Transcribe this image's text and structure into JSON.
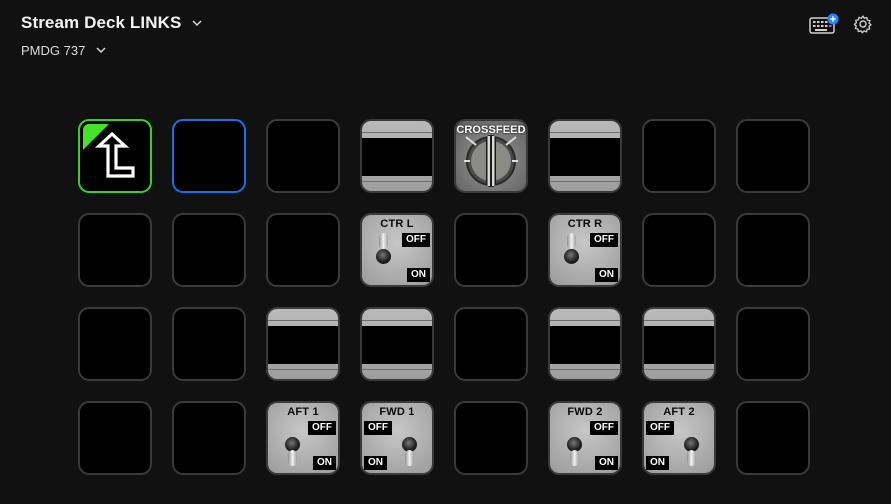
{
  "header": {
    "app_title": "Stream Deck LINKS",
    "profile": "PMDG 737"
  },
  "icons": {
    "title_dropdown": "chevron-down-icon",
    "profile_dropdown": "chevron-down-icon",
    "device_store": "keyboard-plus-icon",
    "settings": "gear-icon"
  },
  "colors": {
    "background": "#111111",
    "key_border": "#3a3a3a",
    "selected_border": "#1a6fe8",
    "back_border": "#37d02a",
    "badge_blue": "#1e88ff"
  },
  "keys": {
    "k_2_4": {
      "label": "CTR L",
      "off": "OFF",
      "on": "ON"
    },
    "k_2_6": {
      "label": "CTR R",
      "off": "OFF",
      "on": "ON"
    },
    "k_1_5": {
      "label": "CROSSFEED"
    },
    "k_4_3": {
      "label": "AFT 1",
      "off": "OFF",
      "on": "ON"
    },
    "k_4_4": {
      "label": "FWD 1",
      "off": "OFF",
      "on": "ON"
    },
    "k_4_6": {
      "label": "FWD 2",
      "off": "OFF",
      "on": "ON"
    },
    "k_4_7": {
      "label": "AFT 2",
      "off": "OFF",
      "on": "ON"
    }
  }
}
